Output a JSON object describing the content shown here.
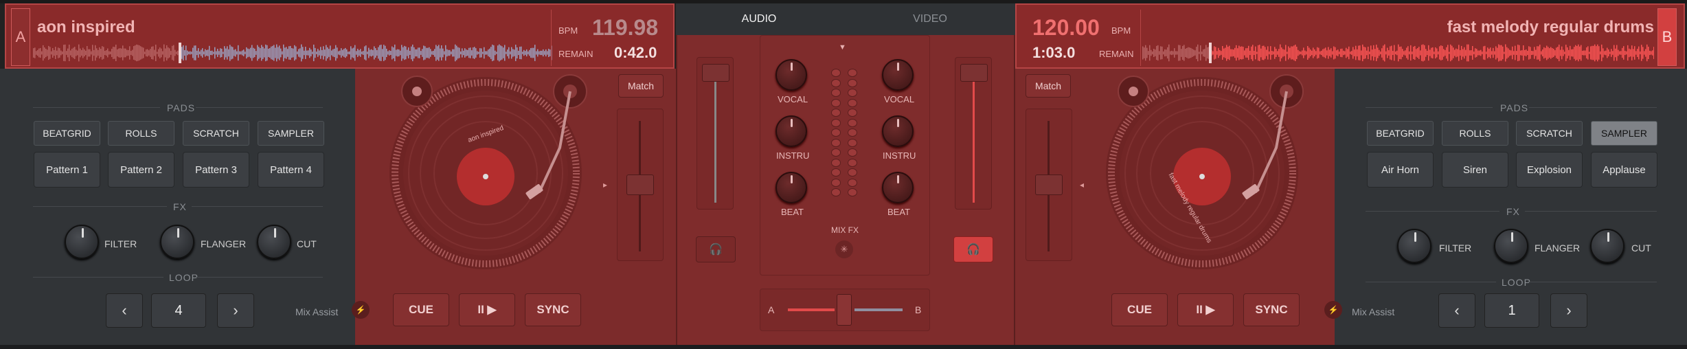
{
  "deck_a": {
    "letter": "A",
    "title": "aon inspired",
    "bpm_label": "BPM",
    "bpm": "119.98",
    "remain_label": "REMAIN",
    "remain": "0:42.0",
    "match_label": "Match",
    "record_label": "aon inspired",
    "progress": 0.28,
    "pads": {
      "section_label": "PADS",
      "tabs": [
        "BEATGRID",
        "ROLLS",
        "SCRATCH",
        "SAMPLER"
      ],
      "active_tab": "BEATGRID",
      "buttons": [
        "Pattern 1",
        "Pattern 2",
        "Pattern 3",
        "Pattern 4"
      ]
    },
    "fx": {
      "section_label": "FX",
      "knobs": [
        "FILTER",
        "FLANGER",
        "CUT"
      ]
    },
    "loop": {
      "section_label": "LOOP",
      "value": "4",
      "prev": "‹",
      "next": "›"
    },
    "mix_assist_label": "Mix Assist",
    "transport": {
      "cue": "CUE",
      "play": "II ▶",
      "sync": "SYNC"
    }
  },
  "deck_b": {
    "letter": "B",
    "title": "fast melody regular drums",
    "bpm_label": "BPM",
    "bpm": "120.00",
    "remain_label": "REMAIN",
    "remain": "1:03.0",
    "match_label": "Match",
    "record_label": "fast melody regular drums",
    "progress": 0.13,
    "pads": {
      "section_label": "PADS",
      "tabs": [
        "BEATGRID",
        "ROLLS",
        "SCRATCH",
        "SAMPLER"
      ],
      "active_tab": "SAMPLER",
      "buttons": [
        "Air Horn",
        "Siren",
        "Explosion",
        "Applause"
      ]
    },
    "fx": {
      "section_label": "FX",
      "knobs": [
        "FILTER",
        "FLANGER",
        "CUT"
      ]
    },
    "loop": {
      "section_label": "LOOP",
      "value": "1",
      "prev": "‹",
      "next": "›"
    },
    "mix_assist_label": "Mix Assist",
    "transport": {
      "cue": "CUE",
      "play": "II ▶",
      "sync": "SYNC"
    }
  },
  "mixer": {
    "tabs": [
      "AUDIO",
      "VIDEO"
    ],
    "active_tab": "AUDIO",
    "eq_left": [
      "VOCAL",
      "INSTRU",
      "BEAT"
    ],
    "eq_right": [
      "VOCAL",
      "INSTRU",
      "BEAT"
    ],
    "mix_fx_label": "MIX FX",
    "crossfader": {
      "left": "A",
      "right": "B",
      "position": 0.5
    }
  },
  "colors": {
    "accent": "#c9413e",
    "deck_bg": "#7c2b2b",
    "panel_bg": "#313437"
  }
}
